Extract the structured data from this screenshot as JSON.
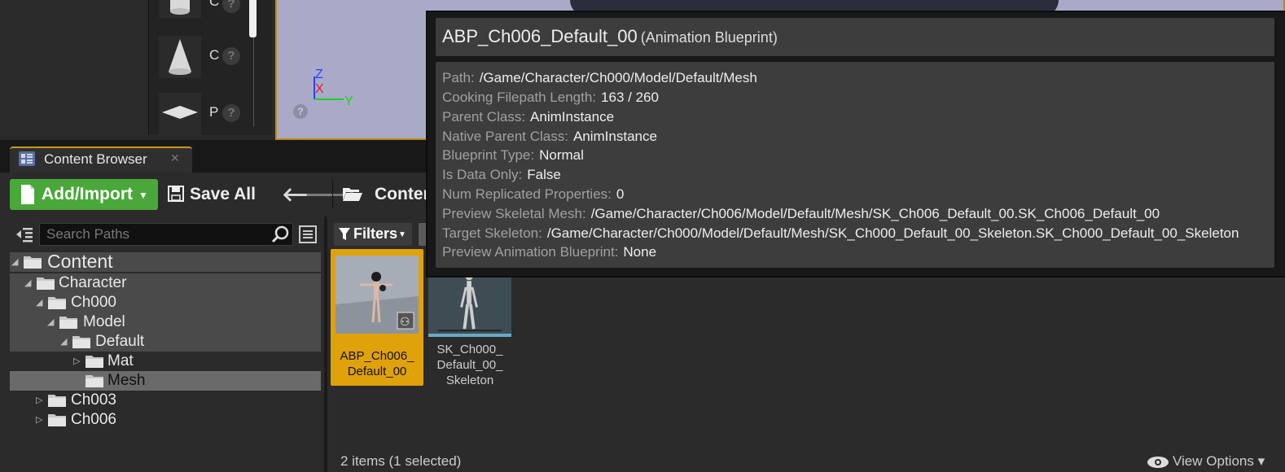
{
  "place_panel": {
    "items": [
      {
        "label": "C",
        "shape": "cylinder-icon"
      },
      {
        "label": "C",
        "shape": "cone-icon"
      },
      {
        "label": "P",
        "shape": "plane-icon"
      }
    ]
  },
  "viewport": {
    "axes": {
      "x": "X",
      "y": "Y",
      "z": "Z"
    },
    "colors": {
      "x": "#e02020",
      "y": "#20d020",
      "z": "#3040ff"
    }
  },
  "content_browser": {
    "tab_label": "Content Browser",
    "toolbar": {
      "add_import_label": "Add/Import",
      "save_all_label": "Save All",
      "breadcrumb": "Conten"
    },
    "paths": {
      "search_placeholder": "Search Paths",
      "tree": [
        {
          "label": "Content",
          "depth": 0,
          "expanded": true
        },
        {
          "label": "Character",
          "depth": 1,
          "expanded": true
        },
        {
          "label": "Ch000",
          "depth": 2,
          "expanded": true
        },
        {
          "label": "Model",
          "depth": 3,
          "expanded": true
        },
        {
          "label": "Default",
          "depth": 4,
          "expanded": true
        },
        {
          "label": "Mat",
          "depth": 5,
          "expanded": false
        },
        {
          "label": "Mesh",
          "depth": 5,
          "selected": true
        },
        {
          "label": "Ch003",
          "depth": 2,
          "expanded": false
        },
        {
          "label": "Ch006",
          "depth": 2,
          "expanded": false
        }
      ]
    },
    "assets": {
      "filters_label": "Filters",
      "items": [
        {
          "label_lines": [
            "ABP_Ch006_",
            "Default_00"
          ],
          "selected": true
        },
        {
          "label_lines": [
            "SK_Ch000_",
            "Default_00_",
            "Skeleton"
          ],
          "selected": false
        }
      ],
      "item_count": "2 items (1 selected)",
      "view_options_label": "View Options"
    }
  },
  "tooltip": {
    "title": "ABP_Ch006_Default_00",
    "type": "(Animation Blueprint)",
    "rows": [
      {
        "key": "Path:",
        "value": "/Game/Character/Ch000/Model/Default/Mesh"
      },
      {
        "key": "Cooking Filepath Length:",
        "value": "163 / 260"
      },
      {
        "key": "Parent Class:",
        "value": "AnimInstance"
      },
      {
        "key": "Native Parent Class:",
        "value": "AnimInstance"
      },
      {
        "key": "Blueprint Type:",
        "value": "Normal"
      },
      {
        "key": "Is Data Only:",
        "value": "False"
      },
      {
        "key": "Num Replicated Properties:",
        "value": "0"
      },
      {
        "key": "Preview Skeletal Mesh:",
        "value": "/Game/Character/Ch006/Model/Default/Mesh/SK_Ch006_Default_00.SK_Ch006_Default_00"
      },
      {
        "key": "Target Skeleton:",
        "value": "/Game/Character/Ch000/Model/Default/Mesh/SK_Ch000_Default_00_Skeleton.SK_Ch000_Default_00_Skeleton"
      },
      {
        "key": "Preview Animation Blueprint:",
        "value": "None"
      }
    ]
  },
  "colors": {
    "accent_orange": "#e0a20a",
    "add_green": "#4aa83a"
  }
}
